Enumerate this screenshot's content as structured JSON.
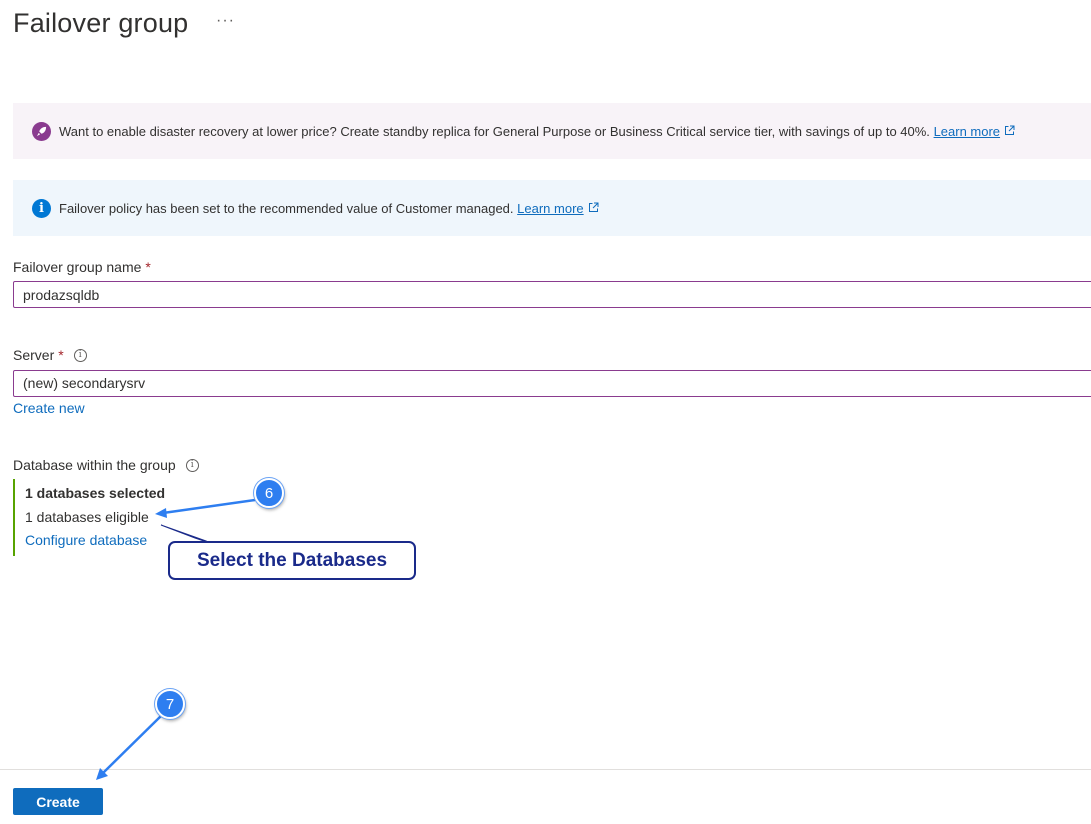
{
  "header": {
    "title": "Failover group",
    "more_label": "···"
  },
  "promo_banner": {
    "text": "Want to enable disaster recovery at lower price? Create standby replica for General Purpose or Business Critical service tier, with savings of up to 40%.",
    "link": "Learn more",
    "icon": "rocket-icon"
  },
  "info_banner": {
    "text": "Failover policy has been set to the recommended value of Customer managed.",
    "link": "Learn more",
    "icon": "info-icon"
  },
  "form": {
    "group_name": {
      "label": "Failover group name",
      "required_mark": "*",
      "value": "prodazsqldb"
    },
    "server": {
      "label": "Server",
      "required_mark": "*",
      "value": "(new) secondarysrv",
      "create_new": "Create new"
    },
    "databases": {
      "label": "Database within the group",
      "selected": "1 databases selected",
      "eligible": "1 databases eligible",
      "configure": "Configure database"
    }
  },
  "footer": {
    "create_label": "Create"
  },
  "annotations": {
    "callout_text": "Select the Databases",
    "step6": "6",
    "step7": "7"
  },
  "colors": {
    "accent": "#0f6cbd",
    "promo_bg": "#f8f3f8",
    "info_bg": "#eff6fc",
    "field_border": "#8a3b8f",
    "selection_bar": "#57a300",
    "callout": "#1a2a8a",
    "step_badge": "#2e7ef0"
  }
}
